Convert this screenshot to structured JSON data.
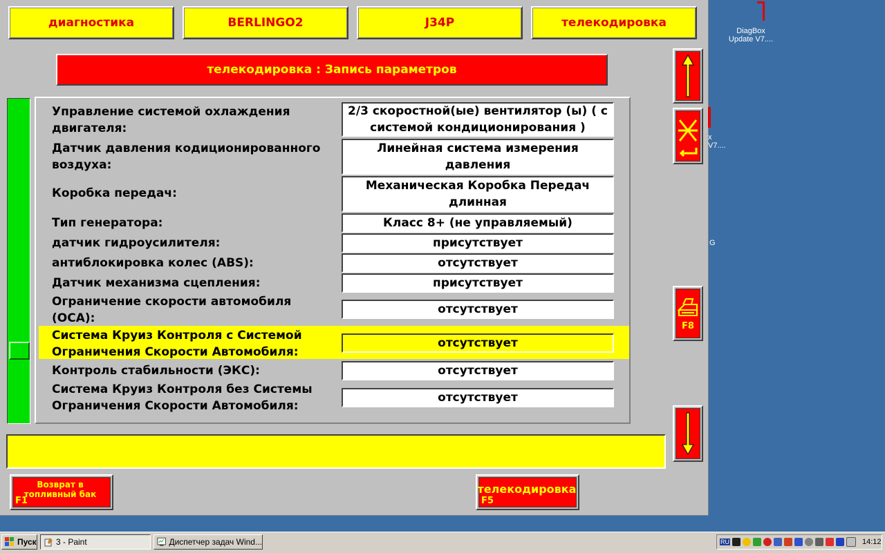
{
  "header": {
    "tabs": [
      "диагностика",
      "BERLINGO2",
      "J34P",
      "телекодировка"
    ]
  },
  "page_title": "телекодировка : Запись параметров",
  "parameters": [
    {
      "label": "Управление системой охлаждения двигателя:",
      "value": "2/3 скоростной(ые) вентилятор (ы)  ( с системой кондиционирования )"
    },
    {
      "label": "Датчик давления кодиционированного воздуха:",
      "value": "Линейная система измерения давления"
    },
    {
      "label": "Коробка передач:",
      "value": "Механическая Коробка Передач длинная"
    },
    {
      "label": "Тип генератора:",
      "value": "Класс 8+ (не управляемый)"
    },
    {
      "label": "датчик гидроусилителя:",
      "value": "присутствует"
    },
    {
      "label": "антиблокировка колес (ABS):",
      "value": "отсутствует"
    },
    {
      "label": "Датчик механизма сцепления:",
      "value": "присутствует"
    },
    {
      "label": "Ограничение скорости автомобиля (ОСА):",
      "value": "отсутствует"
    },
    {
      "label": "Система Круиз Контроля с Системой Ограничения Скорости Автомобиля:",
      "value": "отсутствует",
      "selected": true
    },
    {
      "label": "Контроль стабильности (ЭКС):",
      "value": "отсутствует"
    },
    {
      "label": "Система Круиз Контроля без Системы Ограничения Скорости Автомобиля:",
      "value": "отсутствует"
    }
  ],
  "nav": {
    "up_icon": "arrow-up-icon",
    "cancel_icon": "cancel-enter-icon",
    "print_icon": "printer-icon",
    "print_key": "F8",
    "down_icon": "arrow-down-icon"
  },
  "status_message": "",
  "footer": {
    "back_label": "Возврат в топливный бак",
    "back_key": "F1",
    "telecode_label": "телекодировка",
    "telecode_key": "F5"
  },
  "desktop": {
    "icon_label_1": "DiagBox Update V7....",
    "icon_label_2": "x V7....",
    "icon_label_3": "G"
  },
  "taskbar": {
    "start_label": "Пуск",
    "windows": [
      "3 - Paint",
      "Диспетчер задач Wind..."
    ],
    "tray_lang": "RU",
    "clock": "14:12"
  },
  "colors": {
    "accent_red": "#ff0000",
    "accent_yellow": "#ffff00",
    "scroll_green": "#00e000",
    "desktop_blue": "#3a6ea5"
  }
}
